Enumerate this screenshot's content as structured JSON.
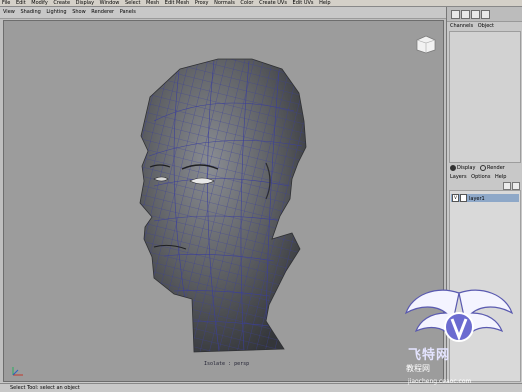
{
  "app": {
    "main_menu": [
      "File",
      "Edit",
      "Modify",
      "Create",
      "Display",
      "Window",
      "Select",
      "Mesh",
      "Edit Mesh",
      "Proxy",
      "Normals",
      "Color",
      "Create UVs",
      "Edit UVs",
      "Help"
    ],
    "panel_menu": [
      "View",
      "Shading",
      "Lighting",
      "Show",
      "Renderer",
      "Panels"
    ]
  },
  "viewport": {
    "camera_label": "persp",
    "camera_prefix": "Isolate :"
  },
  "channel_box": {
    "tabs": [
      "Channels",
      "Object"
    ]
  },
  "layer_editor": {
    "mode_options": [
      {
        "label": "Display",
        "selected": true
      },
      {
        "label": "Render",
        "selected": false
      }
    ],
    "menu": [
      "Layers",
      "Options",
      "Help"
    ],
    "layers": [
      {
        "visible": "V",
        "type": "",
        "name": "layer1",
        "highlight_color": "#8ea8c8"
      }
    ]
  },
  "status_bar": {
    "message": "Select Tool: select an object"
  },
  "watermark": {
    "title": "飞特网",
    "subtitle": "教程网",
    "url": "jiaocheng.ceaoc.com"
  },
  "colors": {
    "viewport_bg": "#9c9c9c",
    "mesh_fill": "#5d5f63",
    "wire": "#3b3f9a",
    "layer_highlight": "#8ea8c8"
  }
}
